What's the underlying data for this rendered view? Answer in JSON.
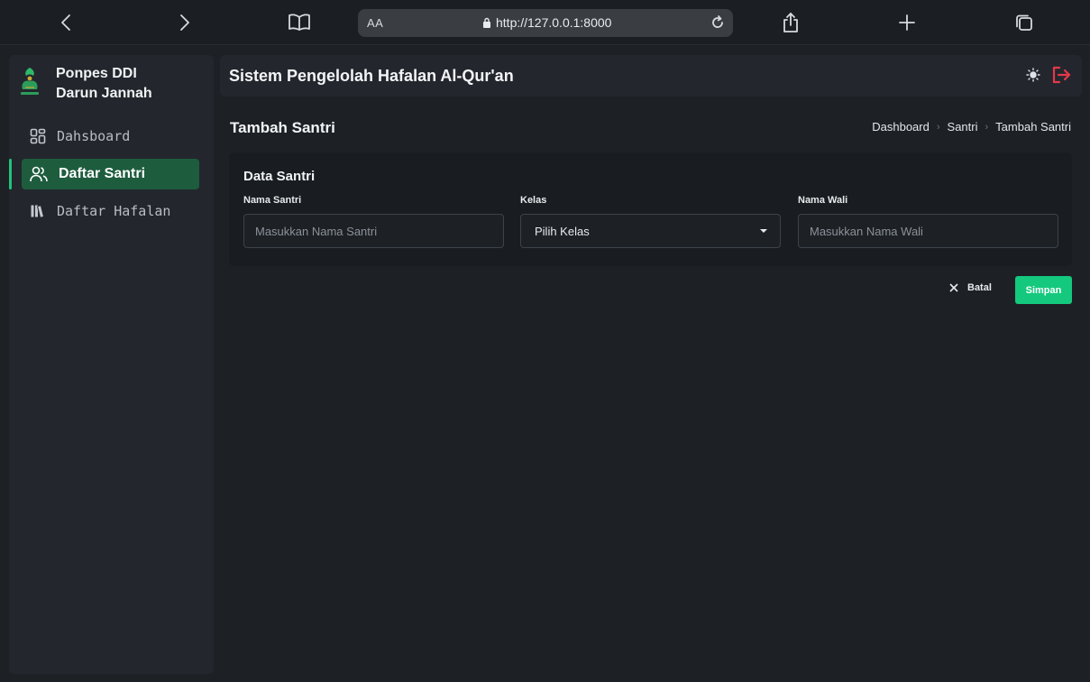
{
  "browser": {
    "aa_label": "AA",
    "url": "http://127.0.0.1:8000"
  },
  "sidebar": {
    "brand": "Ponpes DDI Darun Jannah",
    "items": [
      {
        "label": "Dahsboard",
        "icon": "dashboard-grid-icon",
        "active": false
      },
      {
        "label": "Daftar Santri",
        "icon": "users-icon",
        "active": true
      },
      {
        "label": "Daftar Hafalan",
        "icon": "books-icon",
        "active": false
      }
    ]
  },
  "header": {
    "title": "Sistem Pengelolah  Hafalan Al-Qur'an"
  },
  "page": {
    "title": "Tambah Santri",
    "breadcrumb": [
      "Dashboard",
      "Santri",
      "Tambah Santri"
    ]
  },
  "form": {
    "card_title": "Data Santri",
    "nama_santri": {
      "label": "Nama Santri",
      "placeholder": "Masukkan Nama Santri",
      "value": ""
    },
    "kelas": {
      "label": "Kelas",
      "selected": "Pilih Kelas"
    },
    "nama_wali": {
      "label": "Nama Wali",
      "placeholder": "Masukkan Nama Wali",
      "value": ""
    }
  },
  "actions": {
    "cancel_label": "Batal",
    "save_label": "Simpan"
  },
  "colors": {
    "accent": "#14c97e",
    "active_nav": "#1e5c3e",
    "logout": "#e5384a"
  }
}
